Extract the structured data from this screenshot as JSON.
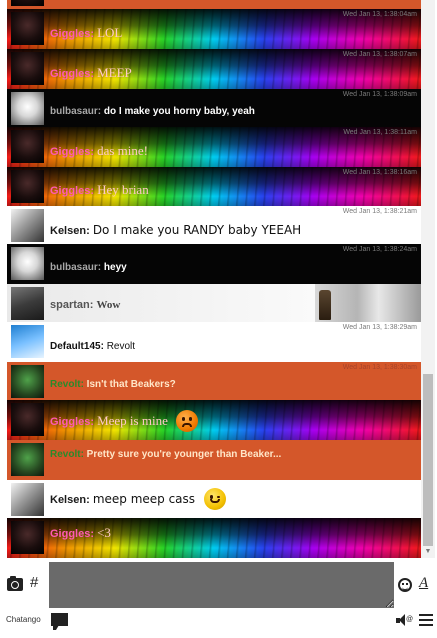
{
  "messages": [
    {
      "user": "Giggles",
      "sep": ": ",
      "text": "LOL",
      "time": "Wed Jan 13, 1:38:04am"
    },
    {
      "user": "Giggles",
      "sep": ": ",
      "text": "MEEP",
      "time": "Wed Jan 13, 1:38:07am"
    },
    {
      "user": "bulbasaur",
      "sep": ": ",
      "text": "do I make you horny baby, yeah",
      "time": "Wed Jan 13, 1:38:09am"
    },
    {
      "user": "Giggles",
      "sep": ": ",
      "text": "das mine!",
      "time": "Wed Jan 13, 1:38:11am"
    },
    {
      "user": "Giggles",
      "sep": ": ",
      "text": "Hey brian",
      "time": "Wed Jan 13, 1:38:16am"
    },
    {
      "user": "Kelsen",
      "sep": ": ",
      "text": "Do I make you RANDY baby YEEAH",
      "time": "Wed Jan 13, 1:38:21am"
    },
    {
      "user": "bulbasaur",
      "sep": ": ",
      "text": "heyy",
      "time": "Wed Jan 13, 1:38:24am"
    },
    {
      "user": "spartan",
      "sep": ": ",
      "text": "Wow",
      "time": ""
    },
    {
      "user": "Default145",
      "sep": ": ",
      "text": "Revolt",
      "time": "Wed Jan 13, 1:38:29am"
    },
    {
      "user": "Revolt",
      "sep": ": ",
      "text": "Isn't that Beakers?",
      "time": "Wed Jan 13, 1:38:30am"
    },
    {
      "user": "Giggles",
      "sep": ": ",
      "text": "Meep is mine",
      "time": "",
      "emoji": "angry-emoji"
    },
    {
      "user": "Revolt",
      "sep": ": ",
      "text": "Pretty sure you're younger than Beaker...",
      "time": ""
    },
    {
      "user": "Kelsen",
      "sep": ": ",
      "text": "meep meep cass",
      "time": "",
      "emoji": "wink-emoji"
    },
    {
      "user": "Giggles",
      "sep": ": ",
      "text": "<3",
      "time": ""
    }
  ],
  "input": {
    "placeholder": "",
    "value": ""
  },
  "toolbar": {
    "hash_label": "#",
    "font_label": "A"
  },
  "footer": {
    "brand": "Chatango",
    "sound_label": "@"
  },
  "colors": {
    "accent_orange": "#d4572a",
    "input_bg": "#6a6a6a",
    "giggles_name": "#ff5ab4"
  },
  "icons": {
    "camera": "camera-icon",
    "emoji": "smiley-icon",
    "font": "font-style-icon",
    "chat": "chat-bubble-icon",
    "sound": "speaker-icon",
    "menu": "hamburger-menu-icon"
  }
}
